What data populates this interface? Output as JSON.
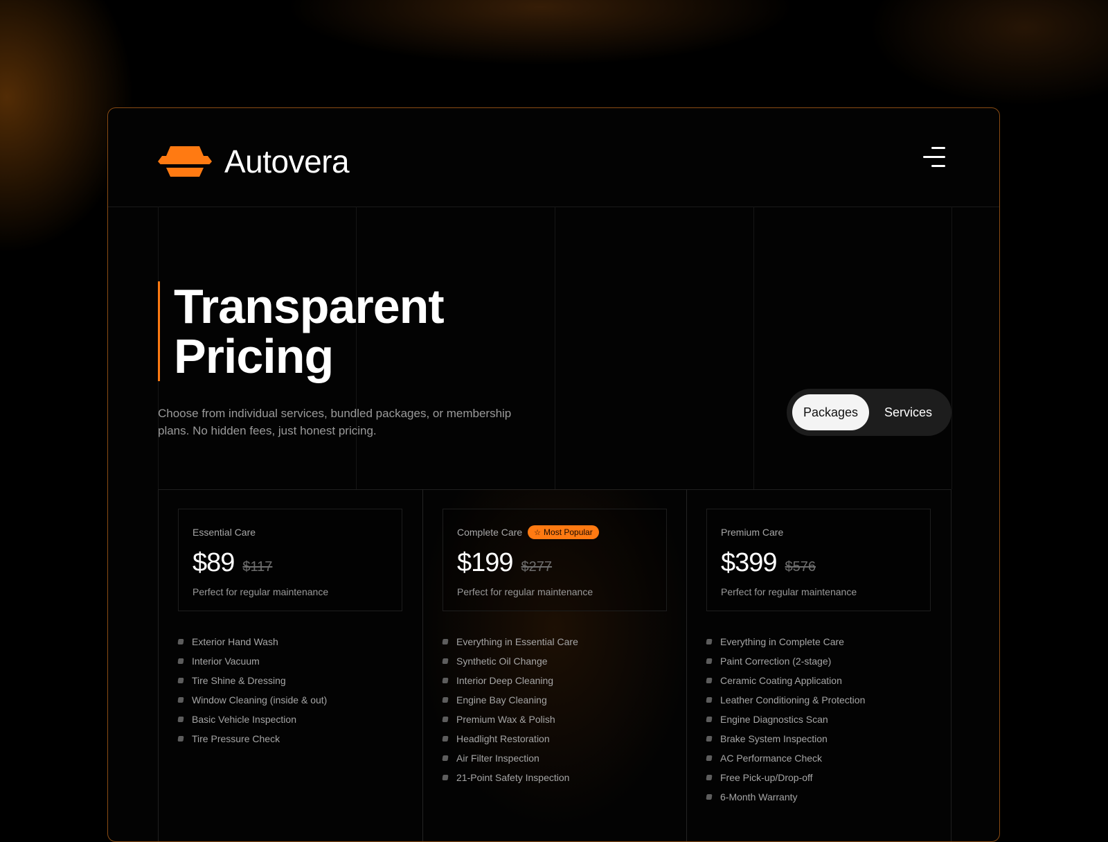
{
  "header": {
    "brand": "Autovera",
    "logo_color": "#ff7a12",
    "menu_icon": "menu-icon"
  },
  "hero": {
    "title_line1": "Transparent",
    "title_line2": "Pricing",
    "subtitle": "Choose from individual services, bundled packages, or membership plans. No hidden fees, just honest pricing."
  },
  "toggle": {
    "options": [
      "Packages",
      "Services"
    ],
    "selected": "Packages"
  },
  "plans": [
    {
      "name": "Essential Care",
      "price": "$89",
      "old_price": "$117",
      "description": "Perfect for regular maintenance",
      "features": [
        "Exterior Hand Wash",
        "Interior Vacuum",
        "Tire Shine & Dressing",
        "Window Cleaning (inside & out)",
        "Basic Vehicle Inspection",
        "Tire Pressure Check"
      ]
    },
    {
      "name": "Complete Care",
      "badge": "Most Popular",
      "badge_icon": "star-icon",
      "price": "$199",
      "old_price": "$277",
      "description": "Perfect for regular maintenance",
      "features": [
        "Everything in Essential Care",
        "Synthetic Oil Change",
        "Interior Deep Cleaning",
        "Engine Bay Cleaning",
        "Premium Wax & Polish",
        "Headlight Restoration",
        "Air Filter Inspection",
        "21-Point Safety Inspection"
      ]
    },
    {
      "name": "Premium Care",
      "price": "$399",
      "old_price": "$576",
      "description": "Perfect for regular maintenance",
      "features": [
        "Everything in Complete Care",
        "Paint Correction (2-stage)",
        "Ceramic Coating Application",
        "Leather Conditioning & Protection",
        "Engine Diagnostics Scan",
        "Brake System Inspection",
        "AC Performance Check",
        "Free Pick-up/Drop-off",
        "6-Month Warranty"
      ]
    }
  ],
  "colors": {
    "accent": "#ff7a12",
    "background": "#030303",
    "frame_border": "#8a4c14"
  }
}
